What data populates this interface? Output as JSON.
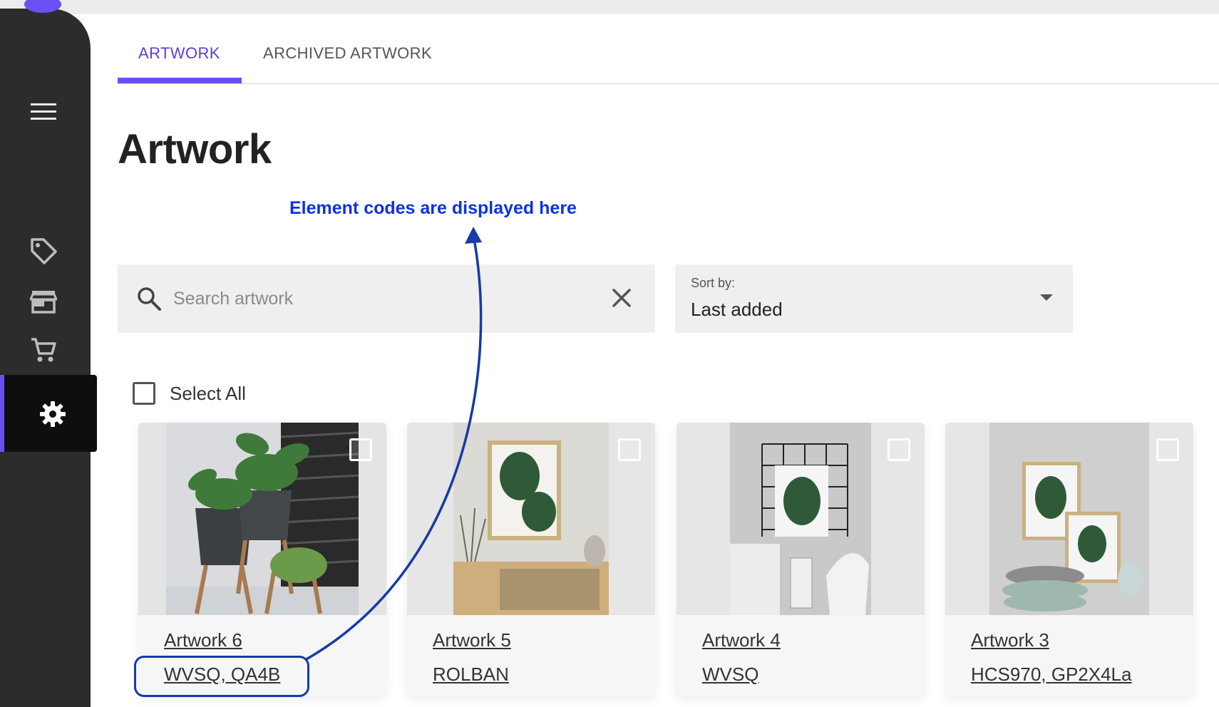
{
  "tabs": [
    {
      "label": "ARTWORK",
      "active": true
    },
    {
      "label": "ARCHIVED ARTWORK",
      "active": false
    }
  ],
  "page": {
    "title": "Artwork"
  },
  "annotation": {
    "text": "Element codes are displayed here",
    "color": "#1030e8"
  },
  "search": {
    "placeholder": "Search artwork",
    "value": ""
  },
  "sort": {
    "label": "Sort by:",
    "value": "Last added"
  },
  "select_all": {
    "label": "Select All"
  },
  "sidebar": {
    "items": [
      {
        "icon": "menu-icon"
      },
      {
        "icon": "tag-icon"
      },
      {
        "icon": "store-icon"
      },
      {
        "icon": "cart-icon"
      },
      {
        "icon": "gear-icon",
        "active": true
      }
    ]
  },
  "cards": [
    {
      "name": "Artwork 6",
      "code": "WVSQ, QA4B"
    },
    {
      "name": "Artwork 5",
      "code": "ROLBAN"
    },
    {
      "name": "Artwork 4",
      "code": "WVSQ"
    },
    {
      "name": "Artwork 3",
      "code": "HCS970, GP2X4La"
    }
  ],
  "colors": {
    "accent": "#6a4ff6",
    "sidebar": "#2c2c2c",
    "annotation": "#1030e8"
  }
}
